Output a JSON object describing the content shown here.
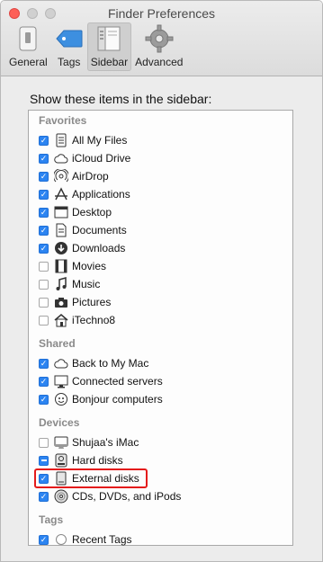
{
  "window": {
    "title": "Finder Preferences",
    "accent": "#2c84f1",
    "highlight_color": "#e41b1b"
  },
  "toolbar": [
    {
      "label": "General",
      "icon": "general-icon",
      "active": false
    },
    {
      "label": "Tags",
      "icon": "tag-icon",
      "active": false
    },
    {
      "label": "Sidebar",
      "icon": "sidebar-icon",
      "active": true
    },
    {
      "label": "Advanced",
      "icon": "gear-icon",
      "active": false
    }
  ],
  "heading": "Show these items in the sidebar:",
  "sections": [
    {
      "title": "Favorites",
      "items": [
        {
          "label": "All My Files",
          "state": "checked",
          "icon": "all-files-icon"
        },
        {
          "label": "iCloud Drive",
          "state": "checked",
          "icon": "cloud-icon"
        },
        {
          "label": "AirDrop",
          "state": "checked",
          "icon": "airdrop-icon"
        },
        {
          "label": "Applications",
          "state": "checked",
          "icon": "applications-icon"
        },
        {
          "label": "Desktop",
          "state": "checked",
          "icon": "desktop-icon"
        },
        {
          "label": "Documents",
          "state": "checked",
          "icon": "documents-icon"
        },
        {
          "label": "Downloads",
          "state": "checked",
          "icon": "downloads-icon"
        },
        {
          "label": "Movies",
          "state": "unchecked",
          "icon": "movies-icon"
        },
        {
          "label": "Music",
          "state": "unchecked",
          "icon": "music-icon"
        },
        {
          "label": "Pictures",
          "state": "unchecked",
          "icon": "camera-icon"
        },
        {
          "label": "iTechno8",
          "state": "unchecked",
          "icon": "home-icon"
        }
      ]
    },
    {
      "title": "Shared",
      "items": [
        {
          "label": "Back to My Mac",
          "state": "checked",
          "icon": "cloud-icon"
        },
        {
          "label": "Connected servers",
          "state": "checked",
          "icon": "monitor-icon"
        },
        {
          "label": "Bonjour computers",
          "state": "checked",
          "icon": "bonjour-icon"
        }
      ]
    },
    {
      "title": "Devices",
      "items": [
        {
          "label": "Shujaa's iMac",
          "state": "unchecked",
          "icon": "imac-icon"
        },
        {
          "label": "Hard disks",
          "state": "mixed",
          "icon": "hard-disk-icon"
        },
        {
          "label": "External disks",
          "state": "checked",
          "icon": "external-disk-icon",
          "highlighted": true
        },
        {
          "label": "CDs, DVDs, and iPods",
          "state": "checked",
          "icon": "cd-icon"
        }
      ]
    },
    {
      "title": "Tags",
      "items": [
        {
          "label": "Recent Tags",
          "state": "checked",
          "icon": "tag-circle-icon"
        }
      ]
    }
  ]
}
